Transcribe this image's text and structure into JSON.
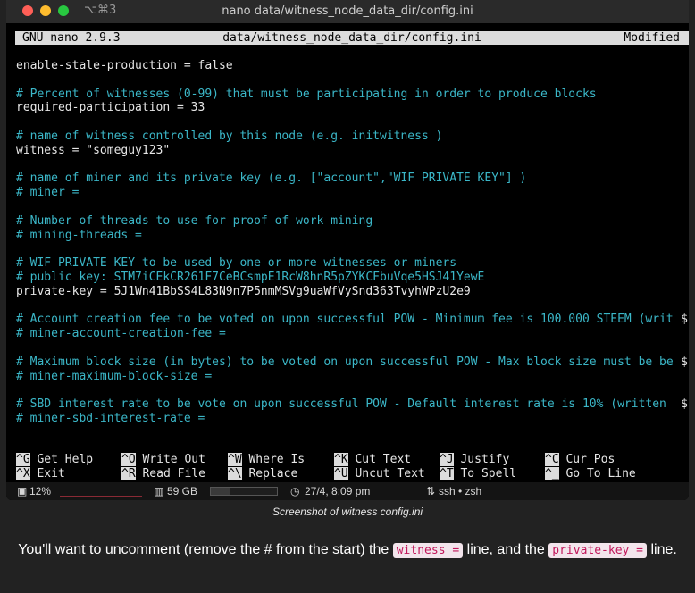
{
  "window": {
    "shortcut": "⌥⌘3",
    "title": "nano data/witness_node_data_dir/config.ini"
  },
  "nano_header": {
    "version": "GNU nano 2.9.3",
    "file": "data/witness_node_data_dir/config.ini",
    "state": "Modified"
  },
  "lines": [
    {
      "type": "t",
      "text": "enable-stale-production = false"
    },
    {
      "type": "b",
      "text": ""
    },
    {
      "type": "c",
      "text": "# Percent of witnesses (0-99) that must be participating in order to produce blocks"
    },
    {
      "type": "t",
      "text": "required-participation = 33"
    },
    {
      "type": "b",
      "text": ""
    },
    {
      "type": "c",
      "text": "# name of witness controlled by this node (e.g. initwitness )"
    },
    {
      "type": "t",
      "text": "witness = \"someguy123\""
    },
    {
      "type": "b",
      "text": ""
    },
    {
      "type": "c",
      "text": "# name of miner and its private key (e.g. [\"account\",\"WIF PRIVATE KEY\"] )"
    },
    {
      "type": "c",
      "text": "# miner ="
    },
    {
      "type": "b",
      "text": ""
    },
    {
      "type": "c",
      "text": "# Number of threads to use for proof of work mining"
    },
    {
      "type": "c",
      "text": "# mining-threads ="
    },
    {
      "type": "b",
      "text": ""
    },
    {
      "type": "c",
      "text": "# WIF PRIVATE KEY to be used by one or more witnesses or miners"
    },
    {
      "type": "c",
      "text": "# public key: STM7iCEkCR261F7CeBCsmpE1RcW8hnR5pZYKCFbuVqe5HSJ41YewE"
    },
    {
      "type": "t",
      "text": "private-key = 5J1Wn41BbSS4L83N9n7P5nmMSVg9uaWfVySnd363TvyhWPzU2e9"
    },
    {
      "type": "b",
      "text": ""
    },
    {
      "type": "c",
      "text": "# Account creation fee to be voted on upon successful POW - Minimum fee is 100.000 STEEM (writ",
      "wrap": "$"
    },
    {
      "type": "c",
      "text": "# miner-account-creation-fee ="
    },
    {
      "type": "b",
      "text": ""
    },
    {
      "type": "c",
      "text": "# Maximum block size (in bytes) to be voted on upon successful POW - Max block size must be be",
      "wrap": "$"
    },
    {
      "type": "c",
      "text": "# miner-maximum-block-size ="
    },
    {
      "type": "b",
      "text": ""
    },
    {
      "type": "c",
      "text": "# SBD interest rate to be vote on upon successful POW - Default interest rate is 10% (written ",
      "wrap": "$"
    },
    {
      "type": "c",
      "text": "# miner-sbd-interest-rate ="
    }
  ],
  "shortcuts": {
    "row1": [
      {
        "key": "^G",
        "label": " Get Help"
      },
      {
        "key": "^O",
        "label": " Write Out"
      },
      {
        "key": "^W",
        "label": " Where Is"
      },
      {
        "key": "^K",
        "label": " Cut Text"
      },
      {
        "key": "^J",
        "label": " Justify"
      },
      {
        "key": "^C",
        "label": " Cur Pos"
      }
    ],
    "row2": [
      {
        "key": "^X",
        "label": " Exit"
      },
      {
        "key": "^R",
        "label": " Read File"
      },
      {
        "key": "^\\",
        "label": " Replace"
      },
      {
        "key": "^U",
        "label": " Uncut Text"
      },
      {
        "key": "^T",
        "label": " To Spell"
      },
      {
        "key": "^_",
        "label": " Go To Line"
      }
    ]
  },
  "status": {
    "cpu_icon": "cpu-icon",
    "cpu": "12%",
    "disk_icon": "disk-icon",
    "disk": "59 GB",
    "disk_used_fraction": 0.3,
    "clock_icon": "clock-icon",
    "time": "27/4, 8:09 pm",
    "session_icon": "session-icon",
    "session": "ssh • zsh"
  },
  "caption": "Screenshot of witness config.ini",
  "paragraph": {
    "part1": "You'll want to uncomment (remove the # from the start) the ",
    "code1": "witness =",
    "part2": " line, and the ",
    "code2": "private-key =",
    "part3": " line."
  }
}
